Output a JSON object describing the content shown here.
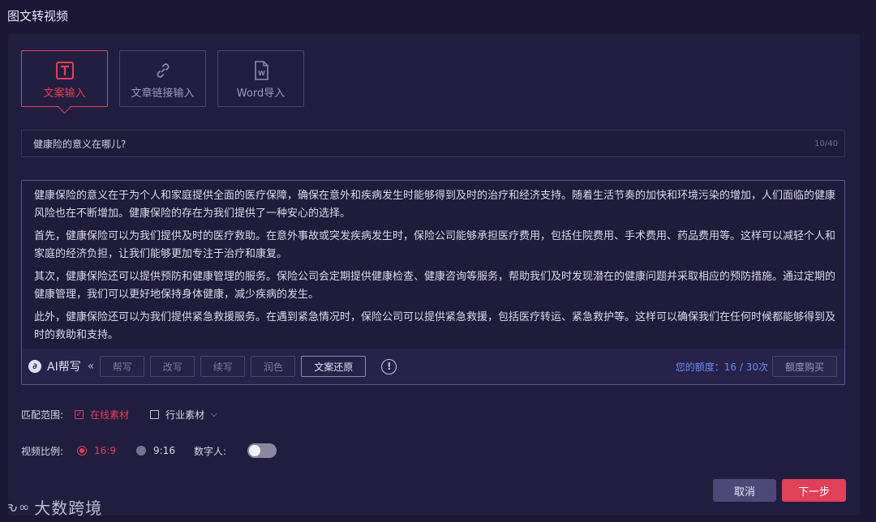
{
  "page_title": "图文转视频",
  "mode_tabs": [
    {
      "label": "文案输入",
      "icon": "text-T-icon",
      "active": true
    },
    {
      "label": "文章链接输入",
      "icon": "link-icon",
      "active": false
    },
    {
      "label": "Word导入",
      "icon": "word-document-icon",
      "active": false
    }
  ],
  "title_field": {
    "value": "健康险的意义在哪儿?",
    "counter": "10/40"
  },
  "editor": {
    "paragraphs": [
      "健康保险的意义在于为个人和家庭提供全面的医疗保障，确保在意外和疾病发生时能够得到及时的治疗和经济支持。随着生活节奏的加快和环境污染的增加，人们面临的健康风险也在不断增加。健康保险的存在为我们提供了一种安心的选择。",
      "首先，健康保险可以为我们提供及时的医疗救助。在意外事故或突发疾病发生时，保险公司能够承担医疗费用，包括住院费用、手术费用、药品费用等。这样可以减轻个人和家庭的经济负担，让我们能够更加专注于治疗和康复。",
      "其次，健康保险还可以提供预防和健康管理的服务。保险公司会定期提供健康检查、健康咨询等服务，帮助我们及时发现潜在的健康问题并采取相应的预防措施。通过定期的健康管理，我们可以更好地保持身体健康，减少疾病的发生。",
      "此外，健康保险还可以为我们提供紧急救援服务。在遇到紧急情况时，保险公司可以提供紧急救援，包括医疗转运、紧急救护等。这样可以确保我们在任何时候都能够得到及时的救助和支持。"
    ]
  },
  "ai_toolbar": {
    "label": "AI帮写",
    "collapse": "«",
    "buttons": [
      "帮写",
      "改写",
      "续写",
      "润色"
    ],
    "restore": "文案还原",
    "warning": "!",
    "quota_label": "您的额度：",
    "quota_value": "16 / 30次",
    "buy": "额度购买"
  },
  "match_range": {
    "label": "匹配范围:",
    "online": {
      "label": "在线素材",
      "checked": true
    },
    "industry": {
      "label": "行业素材",
      "checked": false
    }
  },
  "video_ratio": {
    "label": "视频比例:",
    "options": [
      {
        "label": "16:9",
        "selected": true
      },
      {
        "label": "9:16",
        "selected": false
      }
    ]
  },
  "digital_human": {
    "label": "数字人:",
    "enabled": false
  },
  "buttons": {
    "cancel": "取消",
    "next": "下一步"
  },
  "watermark": {
    "mark": "ԅ∞",
    "text": "大数跨境"
  },
  "colors": {
    "accent": "#e04058",
    "background": "#1b1734",
    "quota": "#6d8cf0"
  }
}
